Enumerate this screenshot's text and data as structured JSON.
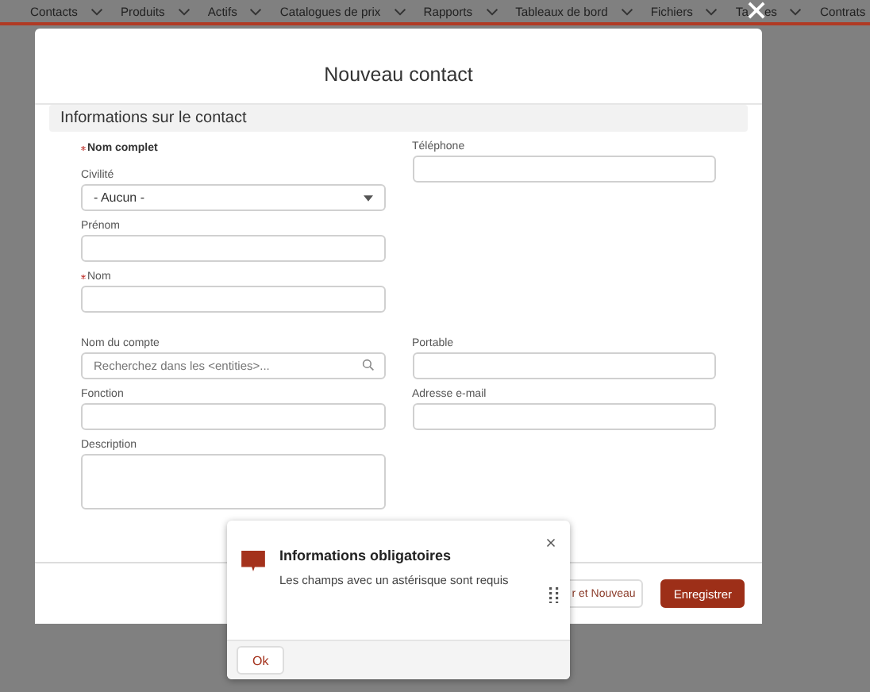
{
  "nav": {
    "items": [
      {
        "label": "Contacts"
      },
      {
        "label": "Produits"
      },
      {
        "label": "Actifs"
      },
      {
        "label": "Catalogues de prix"
      },
      {
        "label": "Rapports"
      },
      {
        "label": "Tableaux de bord"
      },
      {
        "label": "Fichiers"
      },
      {
        "label": "Ta",
        "label_tail": "es"
      },
      {
        "label": "Contrats"
      }
    ]
  },
  "modal": {
    "title": "Nouveau contact",
    "section": "Informations sur le contact",
    "rows": [
      {
        "left": [
          {
            "kind": "heading",
            "label": "Nom complet",
            "required": true
          },
          {
            "kind": "picklist",
            "label": "Civilité",
            "required": false,
            "value": "- Aucun -"
          },
          {
            "kind": "text",
            "label": "Prénom",
            "required": false
          },
          {
            "kind": "text",
            "label": "Nom",
            "required": true
          }
        ],
        "right": [
          {
            "kind": "text",
            "label": "Téléphone",
            "required": false
          }
        ]
      },
      {
        "left": [
          {
            "kind": "lookup",
            "label": "Nom du compte",
            "required": false,
            "placeholder": "Recherchez dans les <entities>..."
          }
        ],
        "right": [
          {
            "kind": "text",
            "label": "Portable",
            "required": false
          }
        ]
      },
      {
        "left": [
          {
            "kind": "text",
            "label": "Fonction",
            "required": false
          }
        ],
        "right": [
          {
            "kind": "text",
            "label": "Adresse e-mail",
            "required": false
          }
        ]
      },
      {
        "left": [
          {
            "kind": "textarea",
            "label": "Description",
            "required": false
          }
        ],
        "right": []
      }
    ],
    "buttons": [
      {
        "label": "r et Nouveau",
        "kind": "neutral"
      },
      {
        "label": "Enregistrer",
        "kind": "brand"
      }
    ]
  },
  "popover": {
    "title": "Informations obligatoires",
    "message": "Les champs avec un astérisque sont requis",
    "button": "Ok"
  }
}
